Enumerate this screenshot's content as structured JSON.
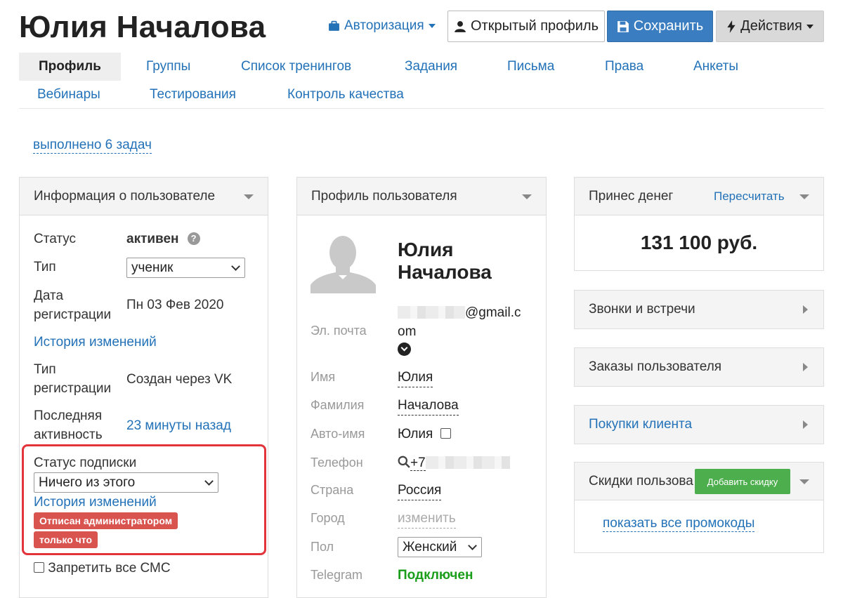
{
  "header": {
    "title": "Юлия Началова",
    "auth_label": "Авторизация",
    "open_profile_label": "Открытый профиль",
    "save_label": "Сохранить",
    "actions_label": "Действия"
  },
  "tabs": [
    {
      "label": "Профиль"
    },
    {
      "label": "Группы"
    },
    {
      "label": "Список тренингов"
    },
    {
      "label": "Задания"
    },
    {
      "label": "Письма"
    },
    {
      "label": "Права"
    },
    {
      "label": "Анкеты"
    },
    {
      "label": "Вебинары"
    },
    {
      "label": "Тестирования"
    },
    {
      "label": "Контроль качества"
    }
  ],
  "tasks_link": "выполнено 6 задач",
  "user_info": {
    "title": "Информация о пользователе",
    "status_label": "Статус",
    "status_value": "активен",
    "help_glyph": "?",
    "type_label": "Тип",
    "type_value": "ученик",
    "reg_date_label_1": "Дата",
    "reg_date_label_2": "регистрации",
    "reg_date_value": "Пн 03 Фев 2020",
    "history_link": "История изменений",
    "reg_type_label_1": "Тип",
    "reg_type_label_2": "регистрации",
    "reg_type_value": "Создан через VK",
    "last_activity_label_1": "Последняя",
    "last_activity_label_2": "активность",
    "last_activity_value": "23 минуты назад",
    "subscription_label": "Статус подписки",
    "subscription_value": "Ничего из этого",
    "subscription_history_link": "История изменений",
    "badge_unsubscribed": "Отписан администратором",
    "badge_time": "только что",
    "sms_label": "Запретить все СМС"
  },
  "profile": {
    "title": "Профиль пользователя",
    "name_line1": "Юлия",
    "name_line2": "Началова",
    "email_label": "Эл. почта",
    "email_suffix_1": "@gmail.c",
    "email_suffix_2": "om",
    "first_name_label": "Имя",
    "first_name": "Юлия",
    "last_name_label": "Фамилия",
    "last_name": "Началова",
    "auto_name_label": "Авто-имя",
    "auto_name": "Юлия",
    "phone_label": "Телефон",
    "phone_prefix": "+7",
    "country_label": "Страна",
    "country": "Россия",
    "city_label": "Город",
    "city": "изменить",
    "gender_label": "Пол",
    "gender": "Женский",
    "telegram_label": "Telegram",
    "telegram": "Подключен"
  },
  "money": {
    "title": "Принес денег",
    "recalc_link": "Пересчитать",
    "amount": "131 100 руб."
  },
  "calls_title": "Звонки и встречи",
  "orders_title": "Заказы пользователя",
  "purchases_title": "Покупки клиента",
  "discounts": {
    "title": "Скидки пользова",
    "add_button": "Добавить скидку",
    "promo_link": "показать все промокоды"
  },
  "colors": {
    "link": "#2372b8",
    "save_button": "#3a7dc0",
    "badge_red": "#d9534f",
    "highlight_border": "#e2343a",
    "add_discount_green": "#4cae4c",
    "telegram_green": "#1a9e1a"
  }
}
